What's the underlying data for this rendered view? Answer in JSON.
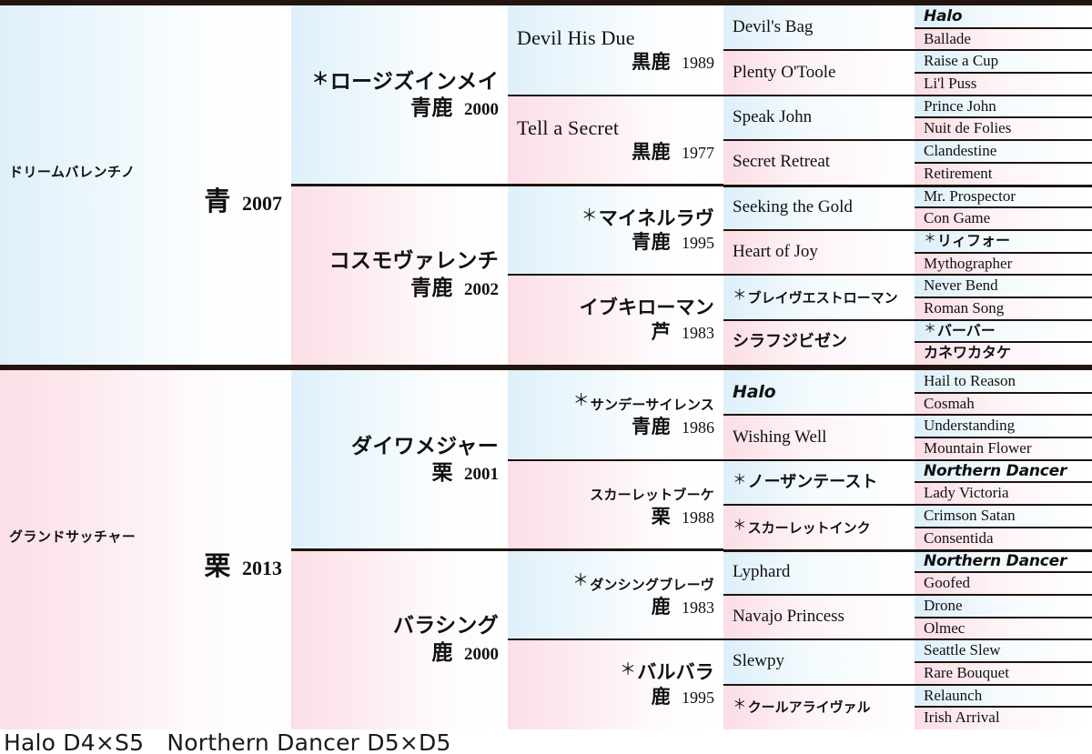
{
  "pedigree": {
    "subject": {
      "sire_branch": {
        "gen1": {
          "name": "ドリームバレンチノ",
          "coat": "青",
          "year": "2007",
          "sex": "m",
          "lang": "jp"
        },
        "gen2": [
          {
            "name": "ロージズインメイ",
            "coat": "青鹿",
            "year": "2000",
            "imported": true,
            "sex": "m",
            "lang": "jp"
          },
          {
            "name": "コスモヴァレンチ",
            "coat": "青鹿",
            "year": "2002",
            "imported": false,
            "sex": "f",
            "lang": "jp"
          }
        ],
        "gen3": [
          {
            "name": "Devil His Due",
            "coat": "黒鹿",
            "year": "1989",
            "imported": false,
            "sex": "m",
            "lang": "en"
          },
          {
            "name": "Tell a Secret",
            "coat": "黒鹿",
            "year": "1977",
            "imported": false,
            "sex": "f",
            "lang": "en"
          },
          {
            "name": "マイネルラヴ",
            "coat": "青鹿",
            "year": "1995",
            "imported": true,
            "sex": "m",
            "lang": "jp"
          },
          {
            "name": "イブキローマン",
            "coat": "芦",
            "year": "1983",
            "imported": false,
            "sex": "f",
            "lang": "jp"
          }
        ],
        "gen4": [
          {
            "name": "Devil's Bag",
            "imported": false,
            "sex": "m",
            "lang": "en",
            "inbred": false
          },
          {
            "name": "Plenty O'Toole",
            "imported": false,
            "sex": "f",
            "lang": "en",
            "inbred": false
          },
          {
            "name": "Speak John",
            "imported": false,
            "sex": "m",
            "lang": "en",
            "inbred": false
          },
          {
            "name": "Secret Retreat",
            "imported": false,
            "sex": "f",
            "lang": "en",
            "inbred": false
          },
          {
            "name": "Seeking the Gold",
            "imported": false,
            "sex": "m",
            "lang": "en",
            "inbred": false
          },
          {
            "name": "Heart of Joy",
            "imported": false,
            "sex": "f",
            "lang": "en",
            "inbred": false
          },
          {
            "name": "ブレイヴエストローマン",
            "imported": true,
            "sex": "m",
            "lang": "jp",
            "inbred": false
          },
          {
            "name": "シラフジビゼン",
            "imported": false,
            "sex": "f",
            "lang": "jp",
            "inbred": false
          }
        ],
        "gen5": [
          {
            "name": "Halo",
            "imported": false,
            "sex": "m",
            "lang": "en",
            "inbred": true
          },
          {
            "name": "Ballade",
            "imported": false,
            "sex": "f",
            "lang": "en",
            "inbred": false
          },
          {
            "name": "Raise a Cup",
            "imported": false,
            "sex": "m",
            "lang": "en",
            "inbred": false
          },
          {
            "name": "Li'l Puss",
            "imported": false,
            "sex": "f",
            "lang": "en",
            "inbred": false
          },
          {
            "name": "Prince John",
            "imported": false,
            "sex": "m",
            "lang": "en",
            "inbred": false
          },
          {
            "name": "Nuit de Folies",
            "imported": false,
            "sex": "f",
            "lang": "en",
            "inbred": false
          },
          {
            "name": "Clandestine",
            "imported": false,
            "sex": "m",
            "lang": "en",
            "inbred": false
          },
          {
            "name": "Retirement",
            "imported": false,
            "sex": "f",
            "lang": "en",
            "inbred": false
          },
          {
            "name": "Mr. Prospector",
            "imported": false,
            "sex": "m",
            "lang": "en",
            "inbred": false
          },
          {
            "name": "Con Game",
            "imported": false,
            "sex": "f",
            "lang": "en",
            "inbred": false
          },
          {
            "name": "リィフォー",
            "imported": true,
            "sex": "m",
            "lang": "jp",
            "inbred": false
          },
          {
            "name": "Mythographer",
            "imported": false,
            "sex": "f",
            "lang": "en",
            "inbred": false
          },
          {
            "name": "Never Bend",
            "imported": false,
            "sex": "m",
            "lang": "en",
            "inbred": false
          },
          {
            "name": "Roman Song",
            "imported": false,
            "sex": "f",
            "lang": "en",
            "inbred": false
          },
          {
            "name": "バーバー",
            "imported": true,
            "sex": "m",
            "lang": "jp",
            "inbred": false
          },
          {
            "name": "カネワカタケ",
            "imported": false,
            "sex": "f",
            "lang": "jp",
            "inbred": false
          }
        ]
      },
      "dam_branch": {
        "gen1": {
          "name": "グランドサッチャー",
          "coat": "栗",
          "year": "2013",
          "sex": "f",
          "lang": "jp"
        },
        "gen2": [
          {
            "name": "ダイワメジャー",
            "coat": "栗",
            "year": "2001",
            "imported": false,
            "sex": "m",
            "lang": "jp"
          },
          {
            "name": "バラシング",
            "coat": "鹿",
            "year": "2000",
            "imported": false,
            "sex": "f",
            "lang": "jp"
          }
        ],
        "gen3": [
          {
            "name": "サンデーサイレンス",
            "coat": "青鹿",
            "year": "1986",
            "imported": true,
            "sex": "m",
            "lang": "jp"
          },
          {
            "name": "スカーレットブーケ",
            "coat": "栗",
            "year": "1988",
            "imported": false,
            "sex": "f",
            "lang": "jp"
          },
          {
            "name": "ダンシングブレーヴ",
            "coat": "鹿",
            "year": "1983",
            "imported": true,
            "sex": "m",
            "lang": "jp"
          },
          {
            "name": "バルバラ",
            "coat": "鹿",
            "year": "1995",
            "imported": true,
            "sex": "f",
            "lang": "jp"
          }
        ],
        "gen4": [
          {
            "name": "Halo",
            "imported": false,
            "sex": "m",
            "lang": "en",
            "inbred": true
          },
          {
            "name": "Wishing Well",
            "imported": false,
            "sex": "f",
            "lang": "en",
            "inbred": false
          },
          {
            "name": "ノーザンテースト",
            "imported": true,
            "sex": "m",
            "lang": "jp",
            "inbred": false
          },
          {
            "name": "スカーレットインク",
            "imported": true,
            "sex": "f",
            "lang": "jp",
            "inbred": false
          },
          {
            "name": "Lyphard",
            "imported": false,
            "sex": "m",
            "lang": "en",
            "inbred": false
          },
          {
            "name": "Navajo Princess",
            "imported": false,
            "sex": "f",
            "lang": "en",
            "inbred": false
          },
          {
            "name": "Slewpy",
            "imported": false,
            "sex": "m",
            "lang": "en",
            "inbred": false
          },
          {
            "name": "クールアライヴァル",
            "imported": true,
            "sex": "f",
            "lang": "jp",
            "inbred": false
          }
        ],
        "gen5": [
          {
            "name": "Hail to Reason",
            "imported": false,
            "sex": "m",
            "lang": "en",
            "inbred": false
          },
          {
            "name": "Cosmah",
            "imported": false,
            "sex": "f",
            "lang": "en",
            "inbred": false
          },
          {
            "name": "Understanding",
            "imported": false,
            "sex": "m",
            "lang": "en",
            "inbred": false
          },
          {
            "name": "Mountain Flower",
            "imported": false,
            "sex": "f",
            "lang": "en",
            "inbred": false
          },
          {
            "name": "Northern Dancer",
            "imported": false,
            "sex": "m",
            "lang": "en",
            "inbred": true
          },
          {
            "name": "Lady Victoria",
            "imported": false,
            "sex": "f",
            "lang": "en",
            "inbred": false
          },
          {
            "name": "Crimson Satan",
            "imported": false,
            "sex": "m",
            "lang": "en",
            "inbred": false
          },
          {
            "name": "Consentida",
            "imported": false,
            "sex": "f",
            "lang": "en",
            "inbred": false
          },
          {
            "name": "Northern Dancer",
            "imported": false,
            "sex": "m",
            "lang": "en",
            "inbred": true
          },
          {
            "name": "Goofed",
            "imported": false,
            "sex": "f",
            "lang": "en",
            "inbred": false
          },
          {
            "name": "Drone",
            "imported": false,
            "sex": "m",
            "lang": "en",
            "inbred": false
          },
          {
            "name": "Olmec",
            "imported": false,
            "sex": "f",
            "lang": "en",
            "inbred": false
          },
          {
            "name": "Seattle Slew",
            "imported": false,
            "sex": "m",
            "lang": "en",
            "inbred": false
          },
          {
            "name": "Rare Bouquet",
            "imported": false,
            "sex": "f",
            "lang": "en",
            "inbred": false
          },
          {
            "name": "Relaunch",
            "imported": false,
            "sex": "m",
            "lang": "en",
            "inbred": false
          },
          {
            "name": "Irish Arrival",
            "imported": false,
            "sex": "f",
            "lang": "en",
            "inbred": false
          }
        ]
      }
    },
    "footer": {
      "inbreeding": "Halo D4×S5　Northern Dancer D5×D5"
    },
    "colors": {
      "male_fill": "#dff0fa",
      "female_fill": "#fbdfe6",
      "border": "#221510",
      "text": "#111111"
    }
  }
}
